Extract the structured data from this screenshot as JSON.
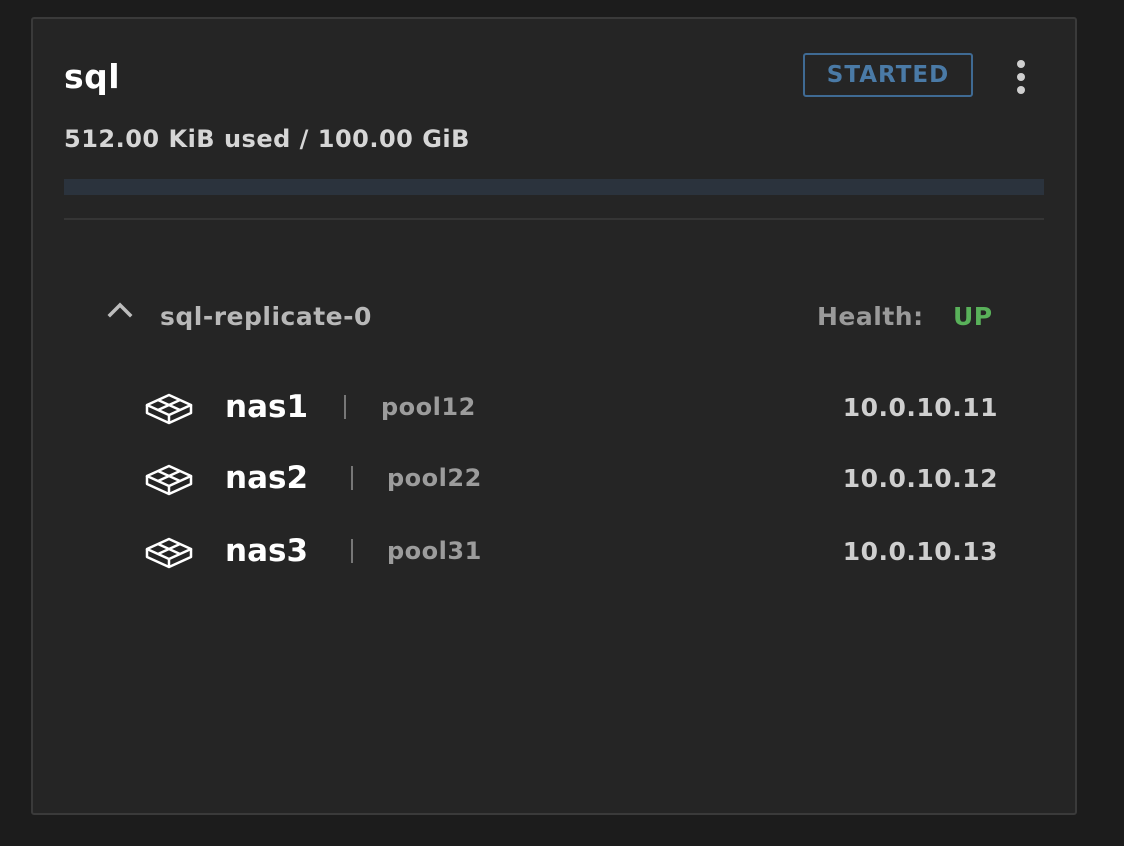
{
  "volume": {
    "name": "sql",
    "status": "STARTED",
    "usage_text": "512.00 KiB used / 100.00 GiB",
    "usage_fraction": 5e-06
  },
  "replica": {
    "name": "sql-replicate-0",
    "health_label": "Health:",
    "health_value": "UP",
    "nodes": [
      {
        "host": "nas1",
        "pool": "pool12",
        "ip": "10.0.10.11"
      },
      {
        "host": "nas2",
        "pool": "pool22",
        "ip": "10.0.10.12"
      },
      {
        "host": "nas3",
        "pool": "pool31",
        "ip": "10.0.10.13"
      }
    ]
  },
  "icons": {
    "menu": "kebab-menu-icon",
    "collapse": "chevron-up-icon",
    "node": "storage-node-icon"
  },
  "colors": {
    "status_accent": "#4a7aa6",
    "health_up": "#59b15a"
  }
}
